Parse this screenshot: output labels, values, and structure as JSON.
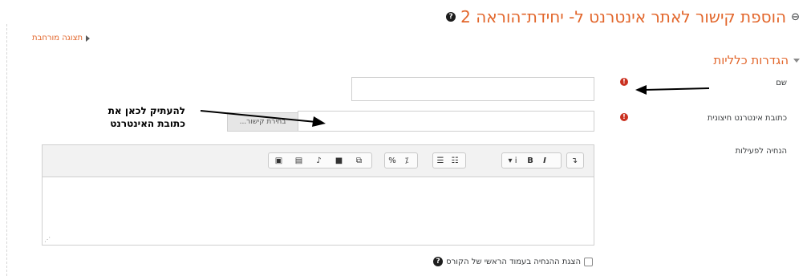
{
  "page": {
    "title": "הוספת קישור לאתר אינטרנט ל- יחידת־הוראה 2",
    "link_icon": "link-icon",
    "help_icon": "question-circle-icon"
  },
  "expand_all": {
    "label": "תצוגה מורחבת",
    "icon": "triangle-left-icon"
  },
  "section": {
    "label": "הגדרות כלליות",
    "icon": "triangle-down-icon"
  },
  "fields": {
    "name": {
      "label": "שם",
      "value": "",
      "required_icon": "exclamation-circle-icon"
    },
    "external_url": {
      "label": "כתובת אינטרנט חיצונית",
      "value": "",
      "button_label": "בחירת קישור...",
      "required_icon": "exclamation-circle-icon"
    },
    "description": {
      "label": "הנחיה לפעילות",
      "value": ""
    }
  },
  "editor_toolbar": {
    "groups": [
      [
        "collapse-icon"
      ],
      [
        "text-color-icon",
        "bold-icon",
        "italic-icon"
      ],
      [
        "unordered-list-icon",
        "ordered-list-icon"
      ],
      [
        "link-icon",
        "unlink-icon"
      ],
      [
        "image-icon",
        "media-icon",
        "record-audio-icon",
        "record-video-icon",
        "manage-files-icon"
      ]
    ],
    "bold_glyph": "B",
    "italic_glyph": "I"
  },
  "annotation": {
    "line1": "להעתיק לכאן את",
    "line2": "כתובת האינטרנט"
  },
  "show_description": {
    "label": "הצגת ההנחיה בעמוד הראשי של הקורס",
    "checked": false,
    "help_icon": "question-circle-icon"
  },
  "colors": {
    "accent": "#e2662b",
    "required": "#ca3120",
    "border": "#cfcfcf",
    "toolbar_bg": "#f2f2f2"
  }
}
